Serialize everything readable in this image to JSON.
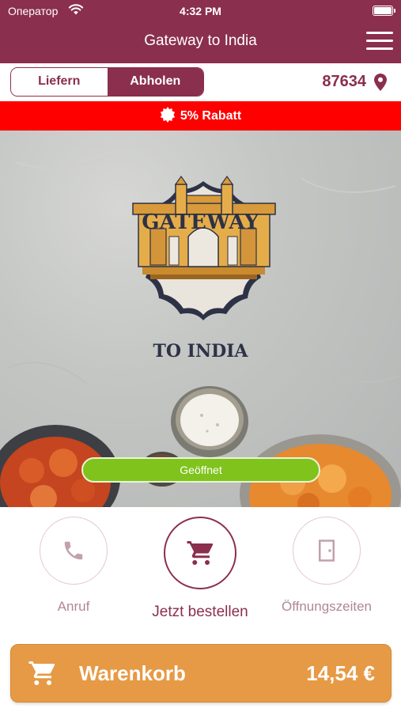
{
  "status_bar": {
    "carrier": "Оператор",
    "time": "4:32 PM"
  },
  "nav": {
    "title": "Gateway to India"
  },
  "mode": {
    "delivery_label": "Liefern",
    "pickup_label": "Abholen",
    "selected": "pickup"
  },
  "location": {
    "zip": "87634"
  },
  "promo": {
    "text": "5% Rabatt"
  },
  "hero": {
    "logo_line1": "GATEWAY",
    "logo_line2": "TO INDIA",
    "open_status": "Geöffnet"
  },
  "actions": {
    "call_label": "Anruf",
    "order_label": "Jetzt bestellen",
    "hours_label": "Öffnungszeiten"
  },
  "cart": {
    "label": "Warenkorb",
    "total": "14,54 €"
  },
  "colors": {
    "brand": "#8a2f4e",
    "promo": "#ff0000",
    "open": "#7fc31c",
    "cart": "#e69a45"
  }
}
